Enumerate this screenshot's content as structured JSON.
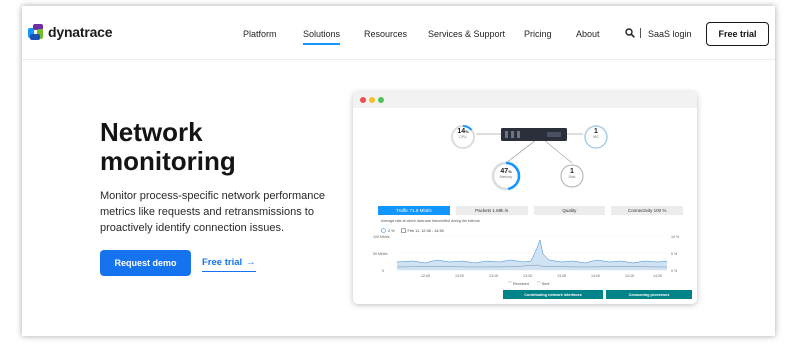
{
  "brand": {
    "name": "dynatrace"
  },
  "nav": {
    "items": [
      "Platform",
      "Solutions",
      "Resources",
      "Services & Support",
      "Pricing",
      "About"
    ],
    "active": "Solutions",
    "saas_login": "SaaS login",
    "free_trial": "Free trial",
    "search_icon": "search-icon"
  },
  "hero": {
    "title_line1": "Network",
    "title_line2": "monitoring",
    "description": "Monitor process-specific network performance metrics like requests and retransmissions to proactively identify connection issues.",
    "cta_label": "Request demo",
    "link_label": "Free trial",
    "link_arrow": "→"
  },
  "screen": {
    "rings": {
      "cpu": {
        "value": "14",
        "unit": "%",
        "label": "CPU"
      },
      "memory": {
        "value": "47",
        "unit": "%",
        "label": "Memory"
      },
      "nic": {
        "value": "1",
        "label": "NIC"
      },
      "disk": {
        "value": "1",
        "label": "Disk"
      }
    },
    "tabs": [
      "Traffic 71.9 Mbit/s",
      "Packets 1.69k /s",
      "Quality",
      "Connectivity 100 %"
    ],
    "active_tab": 0,
    "caption": "Average rate at which data was transmitted during the interval.",
    "meta_percent": "2 %",
    "meta_time": "Feb 11, 12:38 - 14:38",
    "y_left": [
      "100 Mbit/s",
      "50 Mbit/s",
      "0"
    ],
    "y_right": [
      "10 %",
      "5 %",
      "0 %"
    ],
    "x_ticks": [
      "12:45",
      "13:00",
      "13:15",
      "13:30",
      "13:45",
      "14:00",
      "14:15",
      "14:30"
    ],
    "legend": [
      "Received",
      "Sent"
    ],
    "actions": [
      "Contributing network interfaces",
      "Consuming processes"
    ]
  },
  "colors": {
    "accent": "#1496ff",
    "cta": "#1673f0",
    "teal": "#00848a"
  }
}
